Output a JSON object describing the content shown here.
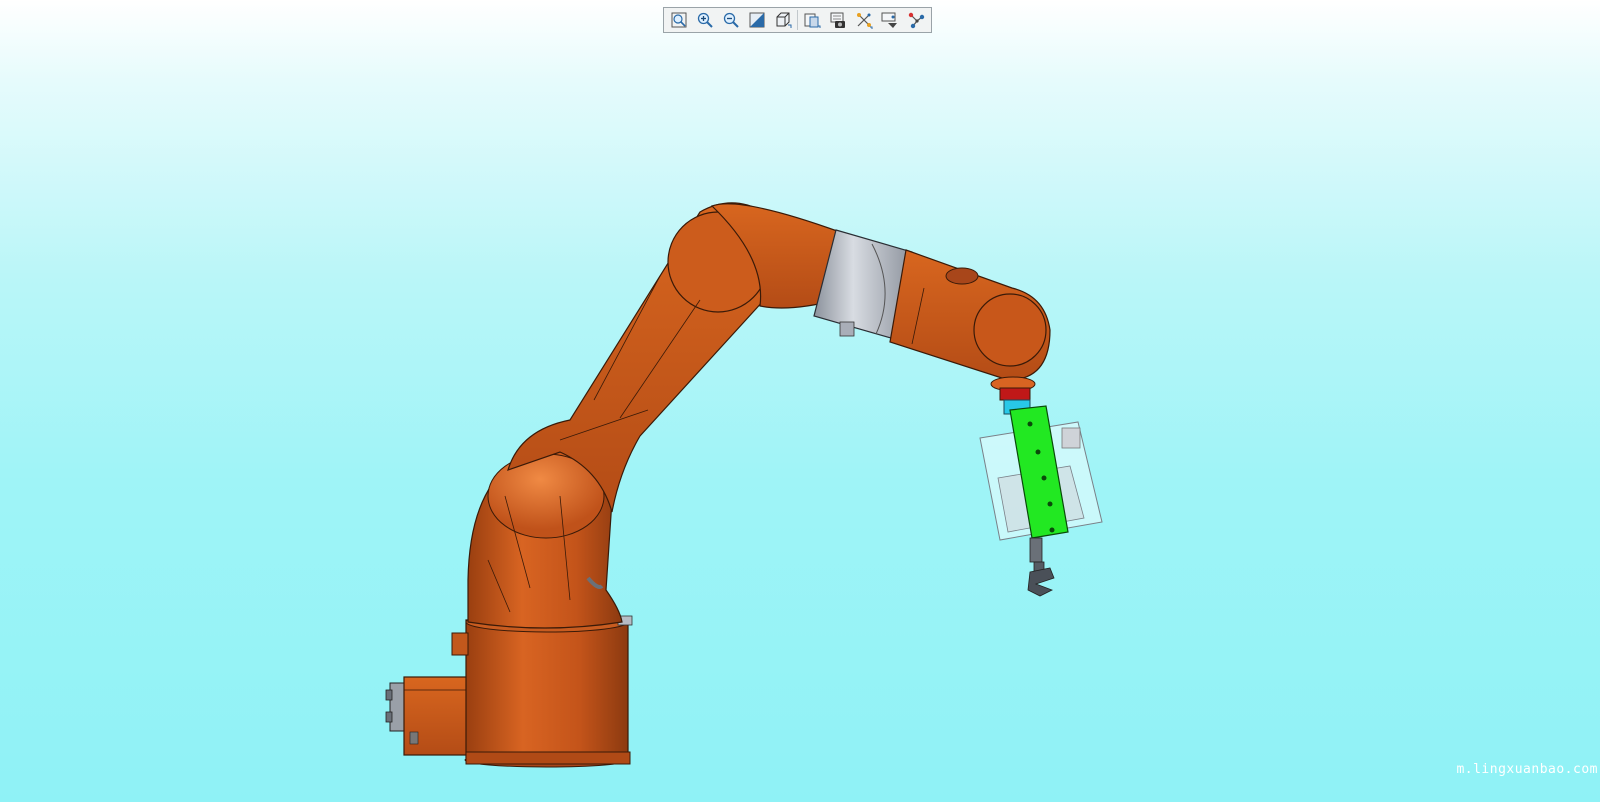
{
  "toolbar": {
    "tools": [
      {
        "name": "zoom-fit-icon"
      },
      {
        "name": "zoom-in-icon"
      },
      {
        "name": "zoom-out-icon"
      },
      {
        "name": "section-view-icon"
      },
      {
        "name": "view-orientation-icon"
      },
      {
        "name": "display-style-icon"
      },
      {
        "name": "screenshot-icon"
      },
      {
        "name": "explode-icon"
      },
      {
        "name": "hide-show-icon"
      },
      {
        "name": "structure-tree-icon"
      }
    ]
  },
  "colors": {
    "robot_orange": "#c8571a",
    "robot_orange_dark": "#8c3a10",
    "joint_gray": "#a9aeb8",
    "gripper_green": "#22e822",
    "flange_red": "#c01818",
    "adapter_cyan": "#28c8e8"
  },
  "watermark": {
    "text": "m.lingxuanbao.com"
  }
}
